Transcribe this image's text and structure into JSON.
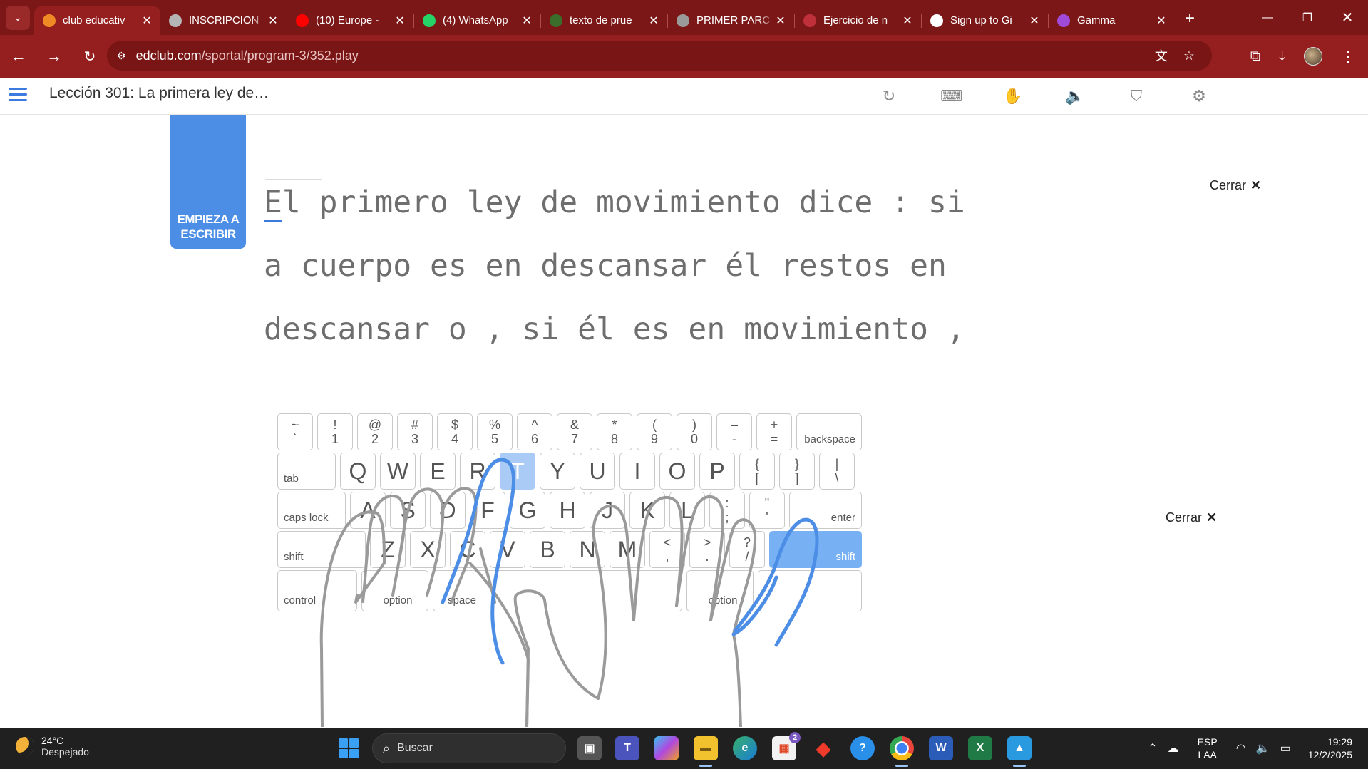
{
  "browser": {
    "tabs": [
      {
        "title": "club educativ",
        "favicon": "flame-icon",
        "color": "#f08a24",
        "active": true
      },
      {
        "title": "INSCRIPCION",
        "favicon": "site-icon",
        "color": "#b5b5b5",
        "active": false
      },
      {
        "title": "(10) Europe -",
        "favicon": "youtube-icon",
        "color": "#ff0000",
        "active": false
      },
      {
        "title": "(4) WhatsApp",
        "favicon": "whatsapp-icon",
        "color": "#25d366",
        "active": false
      },
      {
        "title": "texto de prue",
        "favicon": "doc-icon",
        "color": "#3b6e2a",
        "active": false
      },
      {
        "title": "PRIMER PARC",
        "favicon": "globe-icon",
        "color": "#9a9a9a",
        "active": false
      },
      {
        "title": "Ejercicio de n",
        "favicon": "a-icon",
        "color": "#c0303a",
        "active": false
      },
      {
        "title": "Sign up to Gi",
        "favicon": "github-icon",
        "color": "#ffffff",
        "active": false
      },
      {
        "title": "Gamma",
        "favicon": "gamma-icon",
        "color": "#a04ad8",
        "active": false
      }
    ],
    "url_host": "edclub.com",
    "url_path": "/sportal/program-3/352.play",
    "theme_color": "#951f1f"
  },
  "app": {
    "lesson_title": "Lección 301: La primera ley de…",
    "start_label_1": "EMPIEZA A",
    "start_label_2": "ESCRIBIR",
    "close_label": "Cerrar",
    "typing_lines": [
      "El primero ley de movimiento dice : si",
      "a cuerpo es en descansar él restos en",
      "descansar o , si él es en movimiento ,"
    ],
    "accent_color": "#4c8ee6"
  },
  "keyboard": {
    "row1": [
      {
        "top": "~",
        "bottom": "`"
      },
      {
        "top": "!",
        "bottom": "1"
      },
      {
        "top": "@",
        "bottom": "2"
      },
      {
        "top": "#",
        "bottom": "3"
      },
      {
        "top": "$",
        "bottom": "4"
      },
      {
        "top": "%",
        "bottom": "5"
      },
      {
        "top": "^",
        "bottom": "6"
      },
      {
        "top": "&",
        "bottom": "7"
      },
      {
        "top": "*",
        "bottom": "8"
      },
      {
        "top": "(",
        "bottom": "9"
      },
      {
        "top": ")",
        "bottom": "0"
      },
      {
        "top": "–",
        "bottom": "-"
      },
      {
        "top": "+",
        "bottom": "="
      }
    ],
    "backspace": "backspace",
    "tab": "tab",
    "row2": [
      "Q",
      "W",
      "E",
      "R",
      "T",
      "Y",
      "U",
      "I",
      "O",
      "P"
    ],
    "row2_dual": [
      {
        "top": "{",
        "bottom": "["
      },
      {
        "top": "}",
        "bottom": "]"
      },
      {
        "top": "|",
        "bottom": "\\"
      }
    ],
    "caps": "caps lock",
    "row3": [
      "A",
      "S",
      "D",
      "F",
      "G",
      "H",
      "J",
      "K",
      "L"
    ],
    "row3_dual": [
      {
        "top": ":",
        "bottom": ";"
      },
      {
        "top": "\"",
        "bottom": "'"
      }
    ],
    "enter": "enter",
    "shift_left": "shift",
    "row4": [
      "Z",
      "X",
      "C",
      "V",
      "B",
      "N",
      "M"
    ],
    "row4_dual": [
      {
        "top": "<",
        "bottom": ","
      },
      {
        "top": ">",
        "bottom": "."
      },
      {
        "top": "?",
        "bottom": "/"
      }
    ],
    "shift_right": "shift",
    "control": "control",
    "option_left": "option",
    "space": "space",
    "option_right": "option",
    "highlight_key": "T",
    "highlight_color": "#77b0f3"
  },
  "taskbar": {
    "temperature": "24°C",
    "weather": "Despejado",
    "search_placeholder": "Buscar",
    "store_badge": "2",
    "lang_1": "ESP",
    "lang_2": "LAA",
    "time": "19:29",
    "date": "12/2/2025"
  }
}
